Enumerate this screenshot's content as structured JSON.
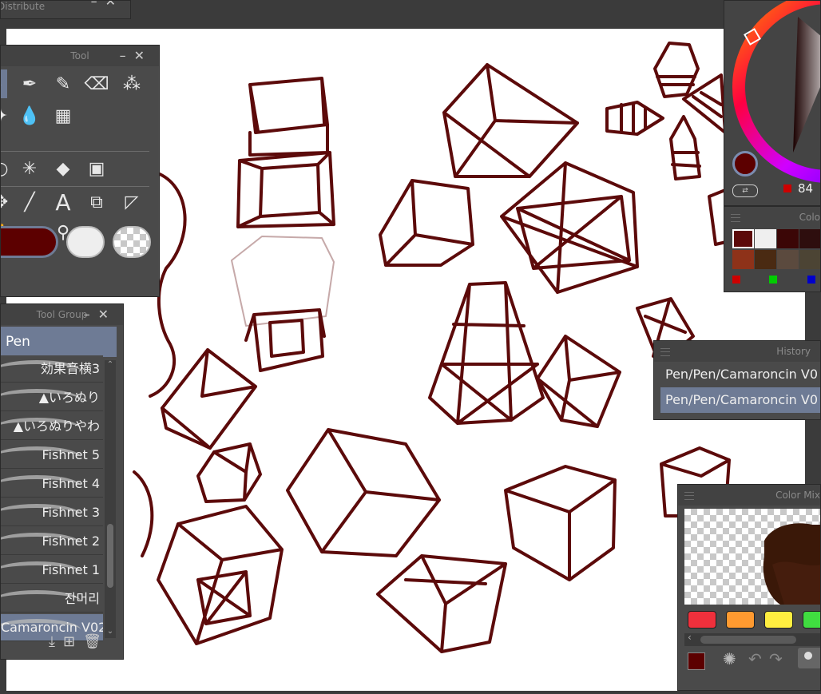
{
  "panels": {
    "distribute": {
      "title": "Distribute"
    },
    "tool": {
      "title": "Tool"
    },
    "tool_group": {
      "title": "Tool Group",
      "active": "Pen",
      "brushes": [
        {
          "name": "効果音横3"
        },
        {
          "name": "▲いろぬり"
        },
        {
          "name": "▲いろぬりやわ"
        },
        {
          "name": "Fishnet 5"
        },
        {
          "name": "Fishnet 4"
        },
        {
          "name": "Fishnet 3"
        },
        {
          "name": "Fishnet 2"
        },
        {
          "name": "Fishnet 1"
        },
        {
          "name": "잔머리"
        },
        {
          "name": "Camaroncin V02"
        }
      ]
    },
    "history": {
      "title": "History",
      "rows": [
        "Pen/Pen/Camaroncin V0",
        "Pen/Pen/Camaroncin V0"
      ]
    },
    "color_wheel": {
      "value": "84",
      "main_color": "#5c0000"
    },
    "color_set": {
      "title": "Colo",
      "swatches": [
        "#5c0a0a",
        "#efefef",
        "#3b0606",
        "#2e0e0e",
        "#2b0f0b",
        "#8e3219",
        "#4a2a12",
        "#5b4a3e",
        "#4c4434",
        "#6b5a3a"
      ]
    },
    "color_mixing": {
      "title": "Color Mix",
      "chips": [
        "#f0303c",
        "#ff9a30",
        "#ffee40",
        "#40dd40"
      ]
    }
  },
  "colors": {
    "stroke": "#5c0a0a",
    "accent": "#6e7b95"
  }
}
